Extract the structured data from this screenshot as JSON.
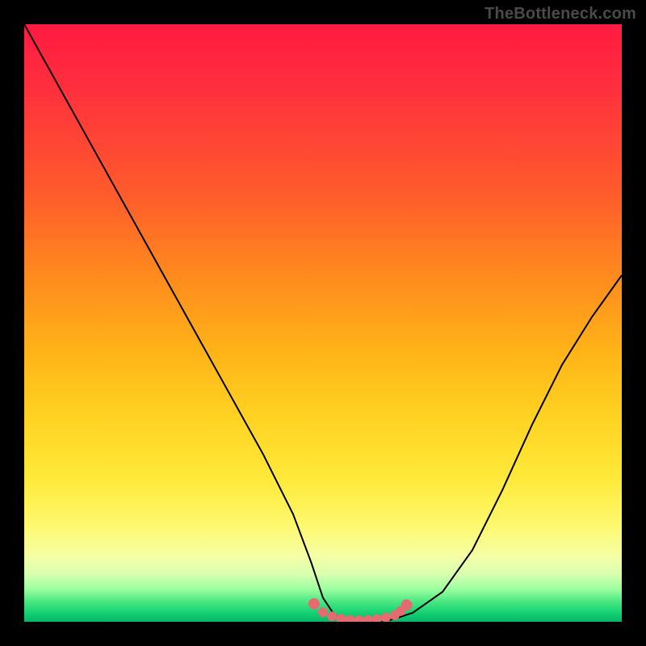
{
  "watermark": {
    "text": "TheBottleneck.com"
  },
  "chart_data": {
    "type": "line",
    "title": "",
    "xlabel": "",
    "ylabel": "",
    "xlim": [
      0,
      100
    ],
    "ylim": [
      0,
      100
    ],
    "grid": false,
    "legend": false,
    "series": [
      {
        "name": "bottleneck-curve",
        "color": "#000000",
        "x": [
          0,
          5,
          10,
          15,
          20,
          25,
          30,
          35,
          40,
          45,
          48,
          50,
          52,
          55,
          58,
          60,
          62,
          65,
          70,
          75,
          80,
          85,
          90,
          95,
          100
        ],
        "y": [
          100,
          91,
          82,
          73,
          64,
          55,
          46,
          37,
          28,
          18,
          10,
          4,
          1,
          0,
          0,
          0,
          0.5,
          1.5,
          5,
          12,
          22,
          33,
          43,
          51,
          58
        ]
      }
    ],
    "valley_marker": {
      "comment": "pink dot-chain along the flat valley bottom",
      "color": "#e46b6f",
      "x": [
        48.5,
        50,
        51.5,
        53,
        54.5,
        56,
        57.5,
        59,
        60.5,
        62,
        63,
        64
      ],
      "y": [
        3.0,
        1.6,
        0.9,
        0.5,
        0.3,
        0.25,
        0.3,
        0.45,
        0.7,
        1.1,
        1.8,
        2.8
      ]
    },
    "background_gradient": {
      "stops": [
        {
          "pos": 0,
          "color": "#ff1a40"
        },
        {
          "pos": 0.28,
          "color": "#ff5a2c"
        },
        {
          "pos": 0.55,
          "color": "#ffb418"
        },
        {
          "pos": 0.76,
          "color": "#ffe93a"
        },
        {
          "pos": 0.92,
          "color": "#d8ffb0"
        },
        {
          "pos": 1.0,
          "color": "#06b567"
        }
      ]
    }
  }
}
